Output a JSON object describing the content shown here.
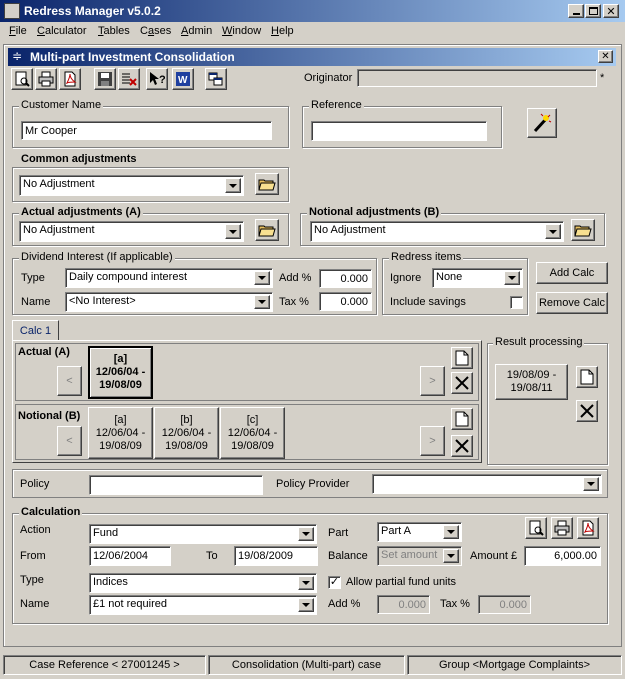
{
  "app": {
    "title": "Redress Manager v5.0.2",
    "menu": [
      "File",
      "Calculator",
      "Tables",
      "Cases",
      "Admin",
      "Window",
      "Help"
    ]
  },
  "doc": {
    "title": "Multi-part Investment Consolidation",
    "originator_label": "Originator",
    "originator_value": "",
    "asterisk": "*"
  },
  "customer": {
    "group_label": "Customer Name",
    "value": "Mr Cooper",
    "reference_label": "Reference",
    "reference_value": ""
  },
  "common_adj": {
    "label": "Common adjustments",
    "value": "No Adjustment"
  },
  "actual_adj": {
    "label": "Actual adjustments (A)",
    "value": "No Adjustment"
  },
  "notional_adj": {
    "label": "Notional adjustments (B)",
    "value": "No Adjustment"
  },
  "dividend": {
    "label": "Dividend Interest (If applicable)",
    "type_label": "Type",
    "type_value": "Daily compound interest",
    "name_label": "Name",
    "name_value": "<No Interest>",
    "add_label": "Add %",
    "add_value": "0.000",
    "tax_label": "Tax %",
    "tax_value": "0.000"
  },
  "redress": {
    "label": "Redress items",
    "ignore_label": "Ignore",
    "ignore_value": "None",
    "savings_label": "Include savings",
    "include_savings": false
  },
  "buttons": {
    "add_calc": "Add Calc",
    "remove_calc": "Remove Calc"
  },
  "calc_tab": "Calc 1",
  "actual": {
    "label": "Actual (A)",
    "items": [
      {
        "tag": "[a]",
        "range1": "12/06/04 -",
        "range2": "19/08/09"
      }
    ]
  },
  "notional": {
    "label": "Notional (B)",
    "items": [
      {
        "tag": "[a]",
        "range1": "12/06/04 -",
        "range2": "19/08/09"
      },
      {
        "tag": "[b]",
        "range1": "12/06/04 -",
        "range2": "19/08/09"
      },
      {
        "tag": "[c]",
        "range1": "12/06/04 -",
        "range2": "19/08/09"
      }
    ]
  },
  "result": {
    "label": "Result processing",
    "range1": "19/08/09 -",
    "range2": "19/08/11"
  },
  "nav": {
    "prev": "<",
    "next": ">"
  },
  "policy": {
    "label": "Policy",
    "value": "",
    "provider_label": "Policy Provider",
    "provider_value": ""
  },
  "calculation": {
    "label": "Calculation",
    "action_label": "Action",
    "action_value": "Fund",
    "part_label": "Part",
    "part_value": "Part A",
    "from_label": "From",
    "from_value": "12/06/2004",
    "to_label": "To",
    "to_value": "19/08/2009",
    "balance_label": "Balance",
    "balance_value": "Set amount",
    "amount_label": "Amount £",
    "amount_value": "6,000.00",
    "type_label": "Type",
    "type_value": "Indices",
    "partial_label": "Allow partial fund units",
    "allow_partial": true,
    "name_label": "Name",
    "name_value": "£1 not required",
    "add_label": "Add %",
    "add_value": "0.000",
    "tax_label": "Tax %",
    "tax_value": "0.000"
  },
  "status": {
    "case_ref": "Case Reference < 27001245 >",
    "case_type": "Consolidation (Multi-part) case",
    "group": "Group <Mortgage Complaints>"
  },
  "colors": {
    "title_bar": "#0a246a",
    "title_bar_end": "#a6caf0",
    "pdf_red": "#c00000",
    "word_blue": "#1f3f9f"
  }
}
